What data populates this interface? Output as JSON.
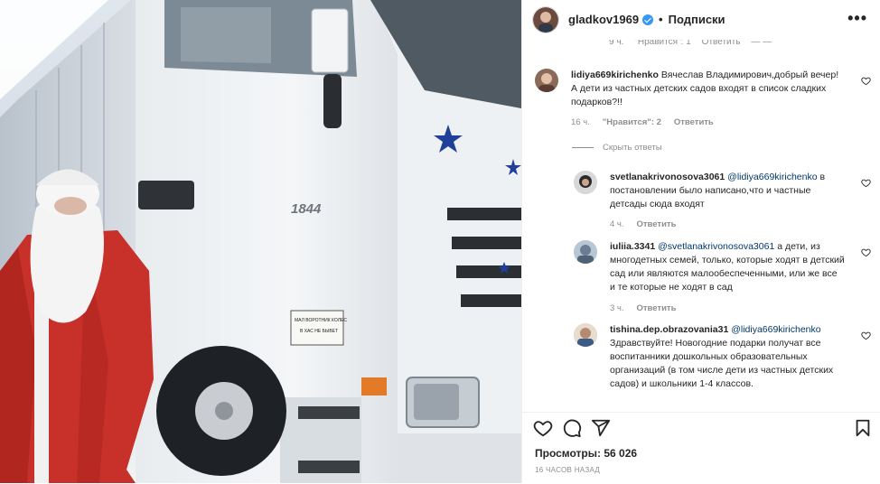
{
  "post": {
    "author": "gladkov1969",
    "separator": "•",
    "follow_label": "Подписки",
    "more_label": "•••"
  },
  "cut_comment_meta": {
    "time": "9 ч.",
    "likes": "\"Нравится\": 1",
    "reply": "Ответить",
    "extra": "— —"
  },
  "comments": [
    {
      "user": "lidiya669kirichenko",
      "text": "Вячеслав Владимирович,добрый вечер! А дети из частных детских садов входят в список сладких подарков?!!",
      "time": "16 ч.",
      "likes": "\"Нравится\": 2",
      "reply": "Ответить"
    }
  ],
  "hide_replies_label": "Скрыть ответы",
  "replies": [
    {
      "user": "svetlanakrivonosova3061",
      "mention": "@lidiya669kirichenko",
      "text": "в постановлении было написано,что и частные детсады сюда входят",
      "time": "4 ч.",
      "reply": "Ответить"
    },
    {
      "user": "iuliia.3341",
      "mention": "@svetlanakrivonosova3061",
      "text": "а дети, из многодетных семей, только, которые ходят в детский сад или являются малообеспеченными, или же все и те которые не ходят в сад",
      "time": "3 ч.",
      "reply": "Ответить"
    },
    {
      "user": "tishina.dep.obrazovania31",
      "mention": "@lidiya669kirichenko",
      "text": "Здравствуйте! Новогодние подарки получат все воспитанники дошкольных образовательных организаций (в том числе дети из частных детских садов) и школьники 1-4 классов.",
      "time": "",
      "reply": ""
    }
  ],
  "stats": {
    "views_label": "Просмотры: 56 026",
    "posted": "16 ЧАСОВ НАЗАД"
  },
  "media": {
    "truck_model": "1844",
    "sticker_line1": "МАЛ ВОРОТНИК КОЛЕС",
    "sticker_line2": "В ХАС НЕ БЫВЕТ",
    "star_color": "#1f3f9a",
    "santa_coat_color": "#c8302a"
  }
}
